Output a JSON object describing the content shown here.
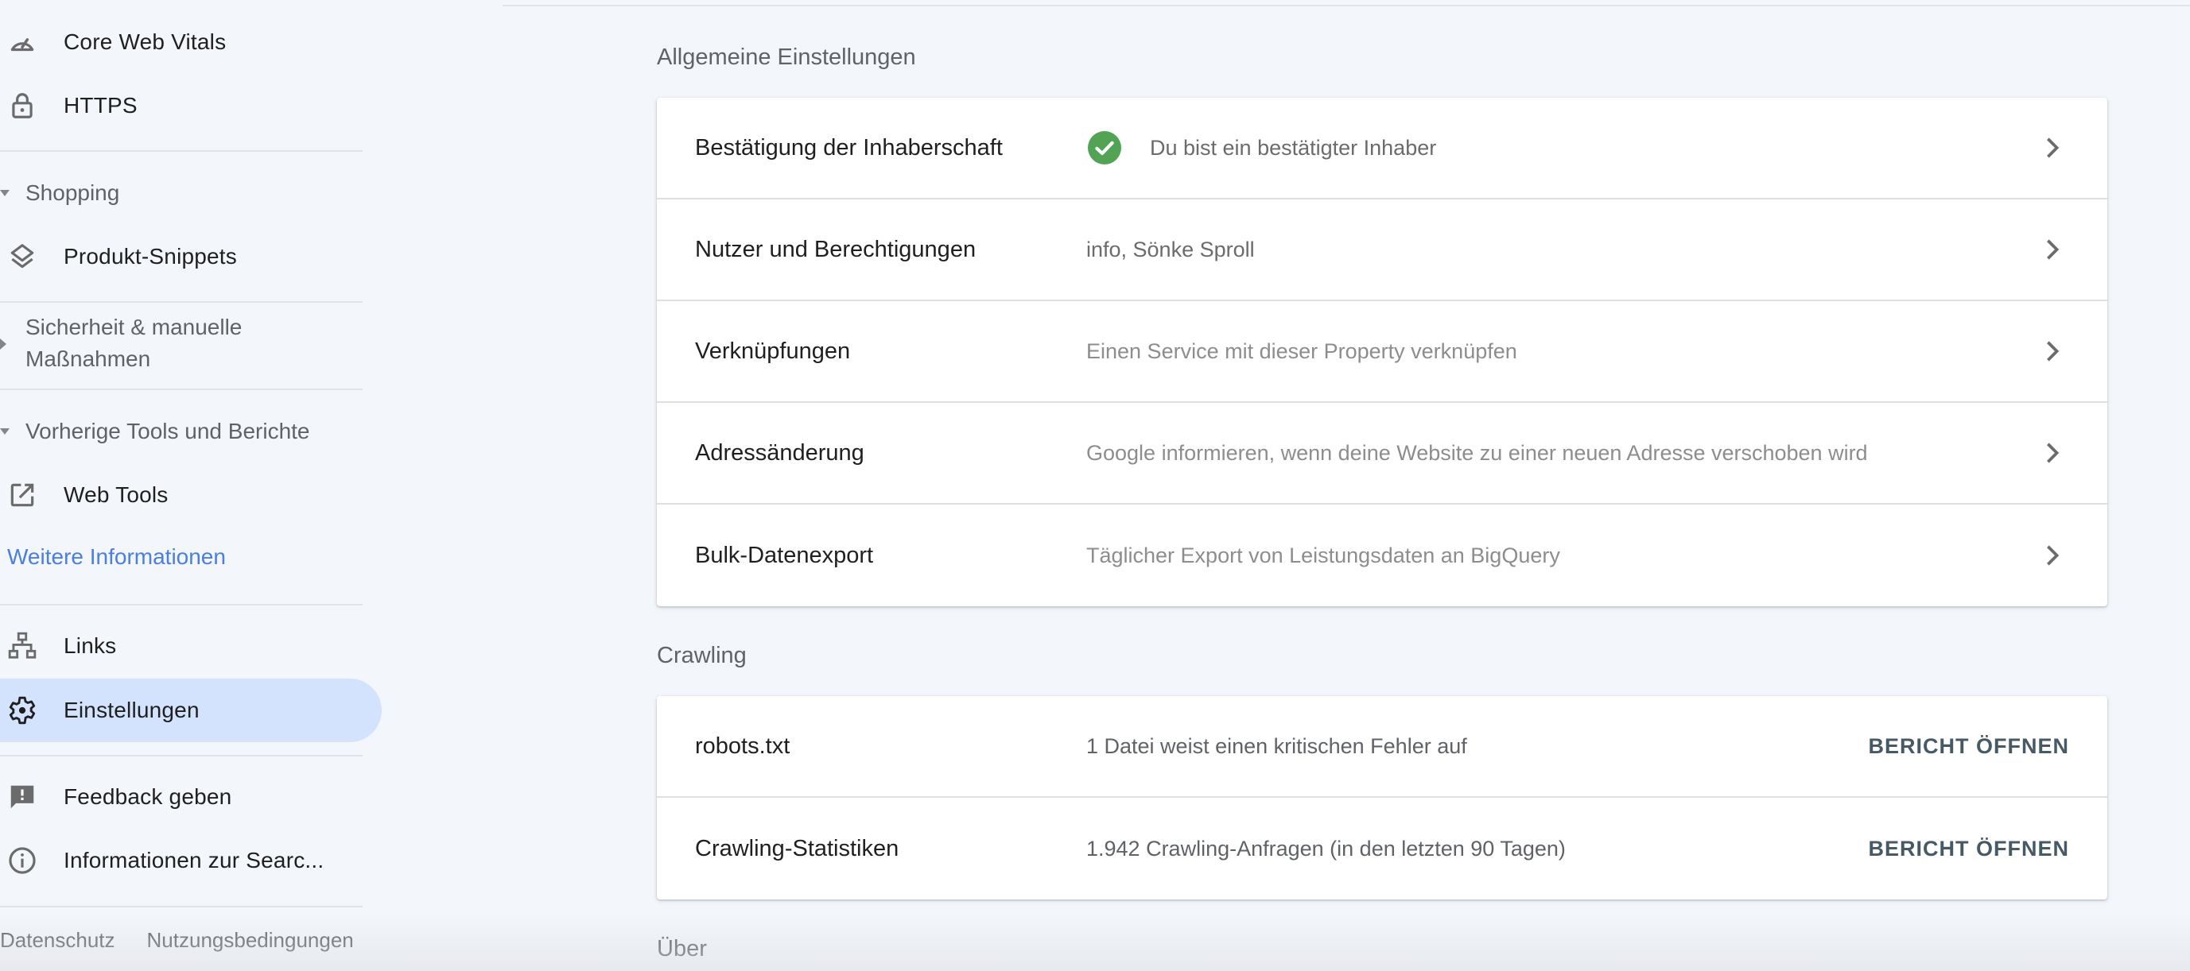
{
  "sidebar": {
    "items": [
      {
        "label": "Core Web Vitals",
        "icon": "speedometer-icon"
      },
      {
        "label": "HTTPS",
        "icon": "lock-icon"
      },
      {
        "label": "Produkt-Snippets",
        "icon": "layers-icon"
      },
      {
        "label": "Web Tools",
        "icon": "open-in-new-icon"
      },
      {
        "label": "Links",
        "icon": "sitemap-icon"
      },
      {
        "label": "Einstellungen",
        "icon": "gear-icon",
        "active": true
      },
      {
        "label": "Feedback geben",
        "icon": "feedback-icon"
      },
      {
        "label": "Informationen zur Searc...",
        "icon": "info-icon"
      }
    ],
    "sections": {
      "shopping": "Shopping",
      "security": "Sicherheit & manuelle Maßnahmen",
      "security_line1": "Sicherheit & manuelle",
      "security_line2": "Maßnahmen",
      "legacy": "Vorherige Tools und Berichte"
    },
    "more_link": "Weitere Informationen",
    "footer": {
      "privacy": "Datenschutz",
      "terms": "Nutzungsbedingungen"
    }
  },
  "main": {
    "general": {
      "title": "Allgemeine Einstellungen",
      "rows": [
        {
          "title": "Bestätigung der Inhaberschaft",
          "value": "Du bist ein bestätigter Inhaber",
          "status": "verified"
        },
        {
          "title": "Nutzer und Berechtigungen",
          "value": "info, Sönke Sproll"
        },
        {
          "title": "Verknüpfungen",
          "value": "Einen Service mit dieser Property verknüpfen"
        },
        {
          "title": "Adressänderung",
          "value": "Google informieren, wenn deine Website zu einer neuen Adresse verschoben wird"
        },
        {
          "title": "Bulk-Datenexport",
          "value": "Täglicher Export von Leistungsdaten an BigQuery"
        }
      ]
    },
    "crawling": {
      "title": "Crawling",
      "rows": [
        {
          "title": "robots.txt",
          "value": "1 Datei weist einen kritischen Fehler auf",
          "action": "BERICHT ÖFFNEN"
        },
        {
          "title": "Crawling-Statistiken",
          "value": "1.942 Crawling-Anfragen (in den letzten 90 Tagen)",
          "action": "BERICHT ÖFFNEN"
        }
      ]
    },
    "about": {
      "title": "Über"
    }
  },
  "colors": {
    "background": "#f3f6fb",
    "active_item": "#d3e3fd",
    "link": "#4a7ee0",
    "verified": "#52a353",
    "action": "#455a64"
  }
}
